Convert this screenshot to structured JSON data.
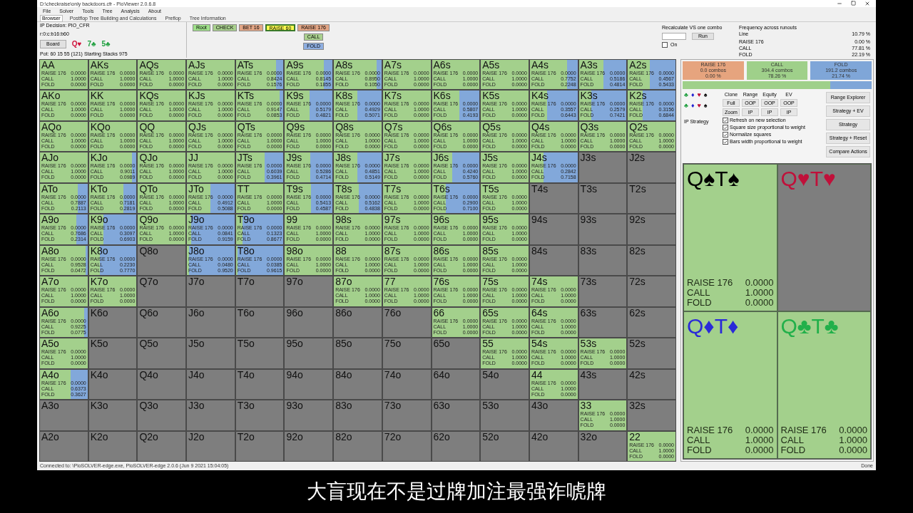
{
  "window": {
    "title": "D:\\checkraise\\only backdoors.cfr - PioViewer 2.0.6.8"
  },
  "menu": [
    "File",
    "Solver",
    "Tools",
    "Tree",
    "Analysis",
    "About"
  ],
  "tabs": [
    {
      "label": "Browser",
      "selected": true
    },
    {
      "label": "Postflop Tree Building and Calculations",
      "selected": false
    },
    {
      "label": "Preflop",
      "selected": false
    },
    {
      "label": "Tree Information",
      "selected": false
    }
  ],
  "node_info": {
    "decision": "IP Decision:  PIO_CFR",
    "line": "r:0:c:b16:b60",
    "board_button": "Board",
    "board": [
      {
        "card": "Q♥",
        "color": "#d0103a"
      },
      {
        "card": "7♣",
        "color": "#20a040"
      },
      {
        "card": "5♣",
        "color": "#20a040"
      }
    ],
    "pot": "Pot: 60 15 55 (121) Starting Stacks 975"
  },
  "action_line": [
    {
      "label": "Root",
      "color": "#9fe08a",
      "selected": false
    },
    {
      "label": "CHECK",
      "color": "#a9d08e",
      "selected": false
    },
    {
      "label": "BET 16",
      "color": "#e2a585",
      "selected": false
    },
    {
      "label": "RAISE 60",
      "color": "#ffff50",
      "selected": true
    }
  ],
  "next_actions": [
    {
      "label": "RAISE 176",
      "color": "#e2a585"
    },
    {
      "label": "CALL",
      "color": "#a9d08e"
    },
    {
      "label": "FOLD",
      "color": "#8eaee0"
    }
  ],
  "recalculate": {
    "label": "Recalculate VS one combo",
    "run_button": "Run",
    "on_label": "On",
    "on": false
  },
  "frequency": {
    "title": "Frequency across runouts",
    "line_label": "Line",
    "line_value": "10.79 %",
    "rows": [
      [
        "RAISE 176",
        "0.00 %"
      ],
      [
        "CALL",
        "77.81 %"
      ],
      [
        "FOLD",
        "22.19 %"
      ]
    ]
  },
  "hands": [
    {
      "name": "AA",
      "actions": [
        [
          "RAISE 176",
          "0.0000"
        ],
        [
          "CALL",
          "1.0000"
        ],
        [
          "FOLD",
          "0.0000"
        ]
      ],
      "level": 0
    },
    {
      "name": "AKs",
      "actions": [
        [
          "RAISE 176",
          "0.0000"
        ],
        [
          "CALL",
          "1.0000"
        ],
        [
          "FOLD",
          "0.0000"
        ]
      ],
      "level": 0
    },
    {
      "name": "AQs",
      "actions": [
        [
          "RAISE 176",
          "0.0000"
        ],
        [
          "CALL",
          "1.0000"
        ],
        [
          "FOLD",
          "0.0000"
        ]
      ],
      "level": 0
    },
    {
      "name": "AJs",
      "actions": [
        [
          "RAISE 176",
          "0.0000"
        ],
        [
          "CALL",
          "1.0000"
        ],
        [
          "FOLD",
          "0.0000"
        ]
      ],
      "level": 0
    },
    {
      "name": "ATs",
      "actions": [
        [
          "RAISE 176",
          "0.0000"
        ],
        [
          "CALL",
          "0.8424"
        ],
        [
          "FOLD",
          "0.1576"
        ]
      ],
      "level": 0.1576
    },
    {
      "name": "A9s",
      "actions": [
        [
          "RAISE 176",
          "0.0000"
        ],
        [
          "CALL",
          "0.8145"
        ],
        [
          "FOLD",
          "0.1855"
        ]
      ],
      "level": 0.1855
    },
    {
      "name": "A8s",
      "actions": [
        [
          "RAISE 176",
          "0.0000"
        ],
        [
          "CALL",
          "0.8950"
        ],
        [
          "FOLD",
          "0.1050"
        ]
      ],
      "level": 0.105
    },
    {
      "name": "A7s",
      "actions": [
        [
          "RAISE 176",
          "0.0000"
        ],
        [
          "CALL",
          "1.0000"
        ],
        [
          "FOLD",
          "0.0000"
        ]
      ],
      "level": 0
    },
    {
      "name": "A6s",
      "actions": [
        [
          "RAISE 176",
          "0.0000"
        ],
        [
          "CALL",
          "1.0000"
        ],
        [
          "FOLD",
          "0.0000"
        ]
      ],
      "level": 0
    },
    {
      "name": "A5s",
      "actions": [
        [
          "RAISE 176",
          "0.0000"
        ],
        [
          "CALL",
          "1.0000"
        ],
        [
          "FOLD",
          "0.0000"
        ]
      ],
      "level": 0
    },
    {
      "name": "A4s",
      "actions": [
        [
          "RAISE 176",
          "0.0000"
        ],
        [
          "CALL",
          "0.7752"
        ],
        [
          "FOLD",
          "0.2248"
        ]
      ],
      "level": 0.2248
    },
    {
      "name": "A3s",
      "actions": [
        [
          "RAISE 176",
          "0.0000"
        ],
        [
          "CALL",
          "0.5186"
        ],
        [
          "FOLD",
          "0.4814"
        ]
      ],
      "level": 0.4814
    },
    {
      "name": "A2s",
      "actions": [
        [
          "RAISE 176",
          "0.0000"
        ],
        [
          "CALL",
          "0.4567"
        ],
        [
          "FOLD",
          "0.5433"
        ]
      ],
      "level": 0.5433
    },
    {
      "name": "AKo",
      "actions": [
        [
          "RAISE 176",
          "0.0000"
        ],
        [
          "CALL",
          "1.0000"
        ],
        [
          "FOLD",
          "0.0000"
        ]
      ],
      "level": 0
    },
    {
      "name": "KK",
      "actions": [
        [
          "RAISE 176",
          "0.0000"
        ],
        [
          "CALL",
          "1.0000"
        ],
        [
          "FOLD",
          "0.0000"
        ]
      ],
      "level": 0
    },
    {
      "name": "KQs",
      "actions": [
        [
          "RAISE 176",
          "0.0000"
        ],
        [
          "CALL",
          "1.0000"
        ],
        [
          "FOLD",
          "0.0000"
        ]
      ],
      "level": 0
    },
    {
      "name": "KJs",
      "actions": [
        [
          "RAISE 176",
          "0.0000"
        ],
        [
          "CALL",
          "1.0000"
        ],
        [
          "FOLD",
          "0.0000"
        ]
      ],
      "level": 0
    },
    {
      "name": "KTs",
      "actions": [
        [
          "RAISE 176",
          "0.0000"
        ],
        [
          "CALL",
          "0.9147"
        ],
        [
          "FOLD",
          "0.0853"
        ]
      ],
      "level": 0.0853
    },
    {
      "name": "K9s",
      "actions": [
        [
          "RAISE 176",
          "0.0000"
        ],
        [
          "CALL",
          "0.5179"
        ],
        [
          "FOLD",
          "0.4821"
        ]
      ],
      "level": 0.4821
    },
    {
      "name": "K8s",
      "actions": [
        [
          "RAISE 176",
          "0.0000"
        ],
        [
          "CALL",
          "0.4929"
        ],
        [
          "FOLD",
          "0.5071"
        ]
      ],
      "level": 0.5071
    },
    {
      "name": "K7s",
      "actions": [
        [
          "RAISE 176",
          "0.0000"
        ],
        [
          "CALL",
          "1.0000"
        ],
        [
          "FOLD",
          "0.0000"
        ]
      ],
      "level": 0
    },
    {
      "name": "K6s",
      "actions": [
        [
          "RAISE 176",
          "0.0000"
        ],
        [
          "CALL",
          "0.5807"
        ],
        [
          "FOLD",
          "0.4193"
        ]
      ],
      "level": 0.4193
    },
    {
      "name": "K5s",
      "actions": [
        [
          "RAISE 176",
          "0.0000"
        ],
        [
          "CALL",
          "1.0000"
        ],
        [
          "FOLD",
          "0.0000"
        ]
      ],
      "level": 0
    },
    {
      "name": "K4s",
      "actions": [
        [
          "RAISE 176",
          "0.0000"
        ],
        [
          "CALL",
          "0.3557"
        ],
        [
          "FOLD",
          "0.6443"
        ]
      ],
      "level": 0.6443
    },
    {
      "name": "K3s",
      "actions": [
        [
          "RAISE 176",
          "0.0000"
        ],
        [
          "CALL",
          "0.2579"
        ],
        [
          "FOLD",
          "0.7421"
        ]
      ],
      "level": 0.7421
    },
    {
      "name": "K2s",
      "actions": [
        [
          "RAISE 176",
          "0.0000"
        ],
        [
          "CALL",
          "0.3156"
        ],
        [
          "FOLD",
          "0.6844"
        ]
      ],
      "level": 0.6844
    },
    {
      "name": "AQo",
      "actions": [
        [
          "RAISE 176",
          "0.0000"
        ],
        [
          "CALL",
          "1.0000"
        ],
        [
          "FOLD",
          "0.0000"
        ]
      ],
      "level": 0
    },
    {
      "name": "KQo",
      "actions": [
        [
          "RAISE 176",
          "0.0000"
        ],
        [
          "CALL",
          "1.0000"
        ],
        [
          "FOLD",
          "0.0000"
        ]
      ],
      "level": 0
    },
    {
      "name": "QQ",
      "actions": [
        [
          "RAISE 176",
          "0.0000"
        ],
        [
          "CALL",
          "1.0000"
        ],
        [
          "FOLD",
          "0.0000"
        ]
      ],
      "level": 0
    },
    {
      "name": "QJs",
      "actions": [
        [
          "RAISE 176",
          "0.0000"
        ],
        [
          "CALL",
          "1.0000"
        ],
        [
          "FOLD",
          "0.0000"
        ]
      ],
      "level": 0
    },
    {
      "name": "QTs",
      "actions": [
        [
          "RAISE 176",
          "0.0000"
        ],
        [
          "CALL",
          "1.0000"
        ],
        [
          "FOLD",
          "0.0000"
        ]
      ],
      "level": 0
    },
    {
      "name": "Q9s",
      "actions": [
        [
          "RAISE 176",
          "0.0000"
        ],
        [
          "CALL",
          "1.0000"
        ],
        [
          "FOLD",
          "0.0000"
        ]
      ],
      "level": 0
    },
    {
      "name": "Q8s",
      "actions": [
        [
          "RAISE 176",
          "0.0000"
        ],
        [
          "CALL",
          "1.0000"
        ],
        [
          "FOLD",
          "0.0000"
        ]
      ],
      "level": 0
    },
    {
      "name": "Q7s",
      "actions": [
        [
          "RAISE 176",
          "0.0000"
        ],
        [
          "CALL",
          "1.0000"
        ],
        [
          "FOLD",
          "0.0000"
        ]
      ],
      "level": 0
    },
    {
      "name": "Q6s",
      "actions": [
        [
          "RAISE 176",
          "0.0000"
        ],
        [
          "CALL",
          "1.0000"
        ],
        [
          "FOLD",
          "0.0000"
        ]
      ],
      "level": 0
    },
    {
      "name": "Q5s",
      "actions": [
        [
          "RAISE 176",
          "0.0000"
        ],
        [
          "CALL",
          "1.0000"
        ],
        [
          "FOLD",
          "0.0000"
        ]
      ],
      "level": 0
    },
    {
      "name": "Q4s",
      "actions": [
        [
          "RAISE 176",
          "0.0000"
        ],
        [
          "CALL",
          "1.0000"
        ],
        [
          "FOLD",
          "0.0000"
        ]
      ],
      "level": 0
    },
    {
      "name": "Q3s",
      "actions": [
        [
          "RAISE 176",
          "0.0000"
        ],
        [
          "CALL",
          "1.0000"
        ],
        [
          "FOLD",
          "0.0000"
        ]
      ],
      "level": 0
    },
    {
      "name": "Q2s",
      "actions": [
        [
          "RAISE 176",
          "0.0000"
        ],
        [
          "CALL",
          "1.0000"
        ],
        [
          "FOLD",
          "0.0000"
        ]
      ],
      "level": 0
    },
    {
      "name": "AJo",
      "actions": [
        [
          "RAISE 176",
          "0.0000"
        ],
        [
          "CALL",
          "1.0000"
        ],
        [
          "FOLD",
          "0.0000"
        ]
      ],
      "level": 0
    },
    {
      "name": "KJo",
      "actions": [
        [
          "RAISE 176",
          "0.0000"
        ],
        [
          "CALL",
          "0.9011"
        ],
        [
          "FOLD",
          "0.0989"
        ]
      ],
      "level": 0.0989
    },
    {
      "name": "QJo",
      "actions": [
        [
          "RAISE 176",
          "0.0000"
        ],
        [
          "CALL",
          "1.0000"
        ],
        [
          "FOLD",
          "0.0000"
        ]
      ],
      "level": 0
    },
    {
      "name": "JJ",
      "actions": [
        [
          "RAISE 176",
          "0.0000"
        ],
        [
          "CALL",
          "1.0000"
        ],
        [
          "FOLD",
          "0.0000"
        ]
      ],
      "level": 0
    },
    {
      "name": "JTs",
      "actions": [
        [
          "RAISE 176",
          "0.0000"
        ],
        [
          "CALL",
          "0.6039"
        ],
        [
          "FOLD",
          "0.3961"
        ]
      ],
      "level": 0.3961
    },
    {
      "name": "J9s",
      "actions": [
        [
          "RAISE 176",
          "0.0000"
        ],
        [
          "CALL",
          "0.5286"
        ],
        [
          "FOLD",
          "0.4714"
        ]
      ],
      "level": 0.4714
    },
    {
      "name": "J8s",
      "actions": [
        [
          "RAISE 176",
          "0.0000"
        ],
        [
          "CALL",
          "0.4851"
        ],
        [
          "FOLD",
          "0.5149"
        ]
      ],
      "level": 0.5149
    },
    {
      "name": "J7s",
      "actions": [
        [
          "RAISE 176",
          "0.0000"
        ],
        [
          "CALL",
          "1.0000"
        ],
        [
          "FOLD",
          "0.0000"
        ]
      ],
      "level": 0
    },
    {
      "name": "J6s",
      "actions": [
        [
          "RAISE 176",
          "0.0000"
        ],
        [
          "CALL",
          "0.4240"
        ],
        [
          "FOLD",
          "0.5760"
        ]
      ],
      "level": 0.576
    },
    {
      "name": "J5s",
      "actions": [
        [
          "RAISE 176",
          "0.0000"
        ],
        [
          "CALL",
          "1.0000"
        ],
        [
          "FOLD",
          "0.0000"
        ]
      ],
      "level": 0
    },
    {
      "name": "J4s",
      "actions": [
        [
          "RAISE 176",
          "0.0000"
        ],
        [
          "CALL",
          "0.2842"
        ],
        [
          "FOLD",
          "0.7158"
        ]
      ],
      "level": 0.7158
    },
    {
      "name": "J3s"
    },
    {
      "name": "J2s"
    },
    {
      "name": "ATo",
      "actions": [
        [
          "RAISE 176",
          "0.0000"
        ],
        [
          "CALL",
          "0.7887"
        ],
        [
          "FOLD",
          "0.2113"
        ]
      ],
      "level": 0.2113
    },
    {
      "name": "KTo",
      "actions": [
        [
          "RAISE 176",
          "0.0000"
        ],
        [
          "CALL",
          "0.7181"
        ],
        [
          "FOLD",
          "0.2819"
        ]
      ],
      "level": 0.2819
    },
    {
      "name": "QTo",
      "actions": [
        [
          "RAISE 176",
          "0.0000"
        ],
        [
          "CALL",
          "1.0000"
        ],
        [
          "FOLD",
          "0.0000"
        ]
      ],
      "level": 0
    },
    {
      "name": "JTo",
      "actions": [
        [
          "RAISE 176",
          "0.0000"
        ],
        [
          "CALL",
          "0.4912"
        ],
        [
          "FOLD",
          "0.5088"
        ]
      ],
      "level": 0.5088
    },
    {
      "name": "TT",
      "actions": [
        [
          "RAISE 176",
          "0.0000"
        ],
        [
          "CALL",
          "1.0000"
        ],
        [
          "FOLD",
          "0.0000"
        ]
      ],
      "level": 0
    },
    {
      "name": "T9s",
      "actions": [
        [
          "RAISE 176",
          "0.0000"
        ],
        [
          "CALL",
          "0.5413"
        ],
        [
          "FOLD",
          "0.4587"
        ]
      ],
      "level": 0.4587
    },
    {
      "name": "T8s",
      "actions": [
        [
          "RAISE 176",
          "0.0000"
        ],
        [
          "CALL",
          "0.5162"
        ],
        [
          "FOLD",
          "0.4838"
        ]
      ],
      "level": 0.4838
    },
    {
      "name": "T7s",
      "actions": [
        [
          "RAISE 176",
          "0.0000"
        ],
        [
          "CALL",
          "1.0000"
        ],
        [
          "FOLD",
          "0.0000"
        ]
      ],
      "level": 0
    },
    {
      "name": "T6s",
      "actions": [
        [
          "RAISE 176",
          "0.0000"
        ],
        [
          "CALL",
          "0.2900"
        ],
        [
          "FOLD",
          "0.7100"
        ]
      ],
      "level": 0.71
    },
    {
      "name": "T5s",
      "actions": [
        [
          "RAISE 176",
          "0.0000"
        ],
        [
          "CALL",
          "1.0000"
        ],
        [
          "FOLD",
          "0.0000"
        ]
      ],
      "level": 0
    },
    {
      "name": "T4s"
    },
    {
      "name": "T3s"
    },
    {
      "name": "T2s"
    },
    {
      "name": "A9o",
      "actions": [
        [
          "RAISE 176",
          "0.0000"
        ],
        [
          "CALL",
          "0.7686"
        ],
        [
          "FOLD",
          "0.2314"
        ]
      ],
      "level": 0.2314
    },
    {
      "name": "K9o",
      "actions": [
        [
          "RAISE 176",
          "0.0000"
        ],
        [
          "CALL",
          "0.3097"
        ],
        [
          "FOLD",
          "0.6903"
        ]
      ],
      "level": 0.6903
    },
    {
      "name": "Q9o",
      "actions": [
        [
          "RAISE 176",
          "0.0000"
        ],
        [
          "CALL",
          "1.0000"
        ],
        [
          "FOLD",
          "0.0000"
        ]
      ],
      "level": 0
    },
    {
      "name": "J9o",
      "actions": [
        [
          "RAISE 176",
          "0.0000"
        ],
        [
          "CALL",
          "0.0841"
        ],
        [
          "FOLD",
          "0.9159"
        ]
      ],
      "level": 0.9159
    },
    {
      "name": "T9o",
      "actions": [
        [
          "RAISE 176",
          "0.0000"
        ],
        [
          "CALL",
          "0.1323"
        ],
        [
          "FOLD",
          "0.8677"
        ]
      ],
      "level": 0.8677
    },
    {
      "name": "99",
      "actions": [
        [
          "RAISE 176",
          "0.0000"
        ],
        [
          "CALL",
          "1.0000"
        ],
        [
          "FOLD",
          "0.0000"
        ]
      ],
      "level": 0
    },
    {
      "name": "98s",
      "actions": [
        [
          "RAISE 176",
          "0.0000"
        ],
        [
          "CALL",
          "1.0000"
        ],
        [
          "FOLD",
          "0.0000"
        ]
      ],
      "level": 0
    },
    {
      "name": "97s",
      "actions": [
        [
          "RAISE 176",
          "0.0000"
        ],
        [
          "CALL",
          "1.0000"
        ],
        [
          "FOLD",
          "0.0000"
        ]
      ],
      "level": 0
    },
    {
      "name": "96s",
      "actions": [
        [
          "RAISE 176",
          "0.0000"
        ],
        [
          "CALL",
          "1.0000"
        ],
        [
          "FOLD",
          "0.0000"
        ]
      ],
      "level": 0
    },
    {
      "name": "95s",
      "actions": [
        [
          "RAISE 176",
          "0.0000"
        ],
        [
          "CALL",
          "1.0000"
        ],
        [
          "FOLD",
          "0.0000"
        ]
      ],
      "level": 0
    },
    {
      "name": "94s"
    },
    {
      "name": "93s"
    },
    {
      "name": "92s"
    },
    {
      "name": "A8o",
      "actions": [
        [
          "RAISE 176",
          "0.0000"
        ],
        [
          "CALL",
          "0.9528"
        ],
        [
          "FOLD",
          "0.0472"
        ]
      ],
      "level": 0.0472
    },
    {
      "name": "K8o",
      "actions": [
        [
          "RAISE 176",
          "0.0000"
        ],
        [
          "CALL",
          "0.2230"
        ],
        [
          "FOLD",
          "0.7770"
        ]
      ],
      "level": 0.777
    },
    {
      "name": "Q8o"
    },
    {
      "name": "J8o",
      "actions": [
        [
          "RAISE 176",
          "0.0000"
        ],
        [
          "CALL",
          "0.0480"
        ],
        [
          "FOLD",
          "0.9520"
        ]
      ],
      "level": 0.952
    },
    {
      "name": "T8o",
      "actions": [
        [
          "RAISE 176",
          "0.0000"
        ],
        [
          "CALL",
          "0.0385"
        ],
        [
          "FOLD",
          "0.9615"
        ]
      ],
      "level": 0.9615
    },
    {
      "name": "98o",
      "actions": [
        [
          "RAISE 176",
          "0.0000"
        ],
        [
          "CALL",
          "1.0000"
        ],
        [
          "FOLD",
          "0.0000"
        ]
      ],
      "level": 0
    },
    {
      "name": "88",
      "actions": [
        [
          "RAISE 176",
          "0.0000"
        ],
        [
          "CALL",
          "1.0000"
        ],
        [
          "FOLD",
          "0.0000"
        ]
      ],
      "level": 0
    },
    {
      "name": "87s",
      "actions": [
        [
          "RAISE 176",
          "0.0000"
        ],
        [
          "CALL",
          "1.0000"
        ],
        [
          "FOLD",
          "0.0000"
        ]
      ],
      "level": 0
    },
    {
      "name": "86s",
      "actions": [
        [
          "RAISE 176",
          "0.0000"
        ],
        [
          "CALL",
          "1.0000"
        ],
        [
          "FOLD",
          "0.0000"
        ]
      ],
      "level": 0
    },
    {
      "name": "85s",
      "actions": [
        [
          "RAISE 176",
          "0.0000"
        ],
        [
          "CALL",
          "1.0000"
        ],
        [
          "FOLD",
          "0.0000"
        ]
      ],
      "level": 0
    },
    {
      "name": "84s"
    },
    {
      "name": "83s"
    },
    {
      "name": "82s"
    },
    {
      "name": "A7o",
      "actions": [
        [
          "RAISE 176",
          "0.0000"
        ],
        [
          "CALL",
          "1.0000"
        ],
        [
          "FOLD",
          "0.0000"
        ]
      ],
      "level": 0
    },
    {
      "name": "K7o",
      "actions": [
        [
          "RAISE 176",
          "0.0000"
        ],
        [
          "CALL",
          "1.0000"
        ],
        [
          "FOLD",
          "0.0000"
        ]
      ],
      "level": 0
    },
    {
      "name": "Q7o"
    },
    {
      "name": "J7o"
    },
    {
      "name": "T7o"
    },
    {
      "name": "97o"
    },
    {
      "name": "87o",
      "actions": [
        [
          "RAISE 176",
          "0.0000"
        ],
        [
          "CALL",
          "1.0000"
        ],
        [
          "FOLD",
          "0.0000"
        ]
      ],
      "level": 0
    },
    {
      "name": "77",
      "actions": [
        [
          "RAISE 176",
          "0.0000"
        ],
        [
          "CALL",
          "1.0000"
        ],
        [
          "FOLD",
          "0.0000"
        ]
      ],
      "level": 0
    },
    {
      "name": "76s",
      "actions": [
        [
          "RAISE 176",
          "0.0000"
        ],
        [
          "CALL",
          "1.0000"
        ],
        [
          "FOLD",
          "0.0000"
        ]
      ],
      "level": 0
    },
    {
      "name": "75s",
      "actions": [
        [
          "RAISE 176",
          "0.0000"
        ],
        [
          "CALL",
          "1.0000"
        ],
        [
          "FOLD",
          "0.0000"
        ]
      ],
      "level": 0
    },
    {
      "name": "74s",
      "actions": [
        [
          "RAISE 176",
          "0.0000"
        ],
        [
          "CALL",
          "1.0000"
        ],
        [
          "FOLD",
          "0.0000"
        ]
      ],
      "level": 0
    },
    {
      "name": "73s"
    },
    {
      "name": "72s"
    },
    {
      "name": "A6o",
      "actions": [
        [
          "RAISE 176",
          "0.0000"
        ],
        [
          "CALL",
          "0.9225"
        ],
        [
          "FOLD",
          "0.0775"
        ]
      ],
      "level": 0.0775
    },
    {
      "name": "K6o"
    },
    {
      "name": "Q6o"
    },
    {
      "name": "J6o"
    },
    {
      "name": "T6o"
    },
    {
      "name": "96o"
    },
    {
      "name": "86o"
    },
    {
      "name": "76o"
    },
    {
      "name": "66",
      "actions": [
        [
          "RAISE 176",
          "0.0000"
        ],
        [
          "CALL",
          "1.0000"
        ],
        [
          "FOLD",
          "0.0000"
        ]
      ],
      "level": 0
    },
    {
      "name": "65s",
      "actions": [
        [
          "RAISE 176",
          "0.0000"
        ],
        [
          "CALL",
          "1.0000"
        ],
        [
          "FOLD",
          "0.0000"
        ]
      ],
      "level": 0
    },
    {
      "name": "64s",
      "actions": [
        [
          "RAISE 176",
          "0.0000"
        ],
        [
          "CALL",
          "1.0000"
        ],
        [
          "FOLD",
          "0.0000"
        ]
      ],
      "level": 0
    },
    {
      "name": "63s"
    },
    {
      "name": "62s"
    },
    {
      "name": "A5o",
      "actions": [
        [
          "RAISE 176",
          "0.0000"
        ],
        [
          "CALL",
          "1.0000"
        ],
        [
          "FOLD",
          "0.0000"
        ]
      ],
      "level": 0
    },
    {
      "name": "K5o"
    },
    {
      "name": "Q5o"
    },
    {
      "name": "J5o"
    },
    {
      "name": "T5o"
    },
    {
      "name": "95o"
    },
    {
      "name": "85o"
    },
    {
      "name": "75o"
    },
    {
      "name": "65o"
    },
    {
      "name": "55",
      "actions": [
        [
          "RAISE 176",
          "0.0000"
        ],
        [
          "CALL",
          "1.0000"
        ],
        [
          "FOLD",
          "0.0000"
        ]
      ],
      "level": 0
    },
    {
      "name": "54s",
      "actions": [
        [
          "RAISE 176",
          "0.0000"
        ],
        [
          "CALL",
          "1.0000"
        ],
        [
          "FOLD",
          "0.0000"
        ]
      ],
      "level": 0
    },
    {
      "name": "53s",
      "actions": [
        [
          "RAISE 176",
          "0.0000"
        ],
        [
          "CALL",
          "1.0000"
        ],
        [
          "FOLD",
          "0.0000"
        ]
      ],
      "level": 0
    },
    {
      "name": "52s"
    },
    {
      "name": "A4o",
      "actions": [
        [
          "RAISE 176",
          "0.0000"
        ],
        [
          "CALL",
          "0.6373"
        ],
        [
          "FOLD",
          "0.3627"
        ]
      ],
      "level": 0.3627
    },
    {
      "name": "K4o"
    },
    {
      "name": "Q4o"
    },
    {
      "name": "J4o"
    },
    {
      "name": "T4o"
    },
    {
      "name": "94o"
    },
    {
      "name": "84o"
    },
    {
      "name": "74o"
    },
    {
      "name": "64o"
    },
    {
      "name": "54o"
    },
    {
      "name": "44",
      "actions": [
        [
          "RAISE 176",
          "0.0000"
        ],
        [
          "CALL",
          "1.0000"
        ],
        [
          "FOLD",
          "0.0000"
        ]
      ],
      "level": 0
    },
    {
      "name": "43s"
    },
    {
      "name": "42s"
    },
    {
      "name": "A3o"
    },
    {
      "name": "K3o"
    },
    {
      "name": "Q3o"
    },
    {
      "name": "J3o"
    },
    {
      "name": "T3o"
    },
    {
      "name": "93o"
    },
    {
      "name": "83o"
    },
    {
      "name": "73o"
    },
    {
      "name": "63o"
    },
    {
      "name": "53o"
    },
    {
      "name": "43o"
    },
    {
      "name": "33",
      "actions": [
        [
          "RAISE 176",
          "0.0000"
        ],
        [
          "CALL",
          "1.0000"
        ],
        [
          "FOLD",
          "0.0000"
        ]
      ],
      "level": 0
    },
    {
      "name": "32s"
    },
    {
      "name": "A2o"
    },
    {
      "name": "K2o"
    },
    {
      "name": "Q2o"
    },
    {
      "name": "J2o"
    },
    {
      "name": "T2o"
    },
    {
      "name": "92o"
    },
    {
      "name": "82o"
    },
    {
      "name": "72o"
    },
    {
      "name": "62o"
    },
    {
      "name": "52o"
    },
    {
      "name": "42o"
    },
    {
      "name": "32o"
    },
    {
      "name": "22",
      "actions": [
        [
          "RAISE 176",
          "0.0000"
        ],
        [
          "CALL",
          "1.0000"
        ],
        [
          "FOLD",
          "0.0000"
        ]
      ],
      "level": 0
    }
  ],
  "strategy_summary": [
    {
      "label": "RAISE 176",
      "combos": "0.0 combos",
      "percent": "0.00 %",
      "color": "#e6a47e"
    },
    {
      "label": "CALL",
      "combos": "304.4 combos",
      "percent": "78.26 %",
      "color": "#9fd08a"
    },
    {
      "label": "FOLD",
      "combos": "191.2 combos",
      "percent": "21.74 %",
      "color": "#7fa6d8"
    }
  ],
  "frequency_bar": [
    {
      "color": "#9fd08a",
      "level": 0.7826
    },
    {
      "color": "#7fa6d8",
      "level": 0.2174
    }
  ],
  "suit_filters": [
    [
      {
        "suit": "♣",
        "color": "#1e9e3e"
      },
      {
        "suit": "♦",
        "color": "#2020d0"
      },
      {
        "suit": "♥",
        "color": "#c0103a"
      },
      {
        "suit": "♠",
        "color": "#000000"
      }
    ],
    [
      {
        "suit": "♣",
        "color": "#1e9e3e"
      },
      {
        "suit": "♦",
        "color": "#2020d0"
      },
      {
        "suit": "♥",
        "color": "#c0103a"
      },
      {
        "suit": "♠",
        "color": "#000000"
      }
    ]
  ],
  "strategy_label": "IP Strategy",
  "view_columns": [
    {
      "header": "Clone",
      "buttons": [
        "Full",
        "Zoom"
      ]
    },
    {
      "header": "Range",
      "buttons": [
        "OOP",
        "IP"
      ]
    },
    {
      "header": "Equity",
      "buttons": [
        "OOP",
        "IP"
      ]
    },
    {
      "header": "EV",
      "buttons": [
        "OOP",
        "IP"
      ]
    }
  ],
  "options": [
    {
      "label": "Refresh on new selection",
      "checked": true
    },
    {
      "label": "Square size proportional to weight",
      "checked": true
    },
    {
      "label": "Normalize squares",
      "checked": true
    },
    {
      "label": "Bars width proportional to weight",
      "checked": true
    }
  ],
  "side_buttons": [
    "Range Explorer",
    "Strategy + EV",
    "Strategy",
    "Strategy + Reset",
    "Compare Actions"
  ],
  "combos": [
    {
      "cards": "Q♠T♠",
      "color": "#000000",
      "actions": [
        [
          "RAISE 176",
          "0.0000"
        ],
        [
          "CALL",
          "1.0000"
        ],
        [
          "FOLD",
          "0.0000"
        ]
      ]
    },
    {
      "cards": "Q♥T♥",
      "color": "#c0103a"
    },
    {
      "cards": "Q♦T♦",
      "color": "#2a2ad8",
      "actions": [
        [
          "RAISE 176",
          "0.0000"
        ],
        [
          "CALL",
          "1.0000"
        ],
        [
          "FOLD",
          "0.0000"
        ]
      ]
    },
    {
      "cards": "Q♣T♣",
      "color": "#22b04a",
      "actions": [
        [
          "RAISE 176",
          "0.0000"
        ],
        [
          "CALL",
          "1.0000"
        ],
        [
          "FOLD",
          "0.0000"
        ]
      ]
    }
  ],
  "status_bar": {
    "connection": "Connected to: \\PioSOLVER-edge.exe, PioSOLVER-edge 2.0.6 (Jun 9 2021 15:04:05)",
    "state": "Done"
  },
  "subtitle": "大盲现在不是过牌加注最强诈唬牌"
}
